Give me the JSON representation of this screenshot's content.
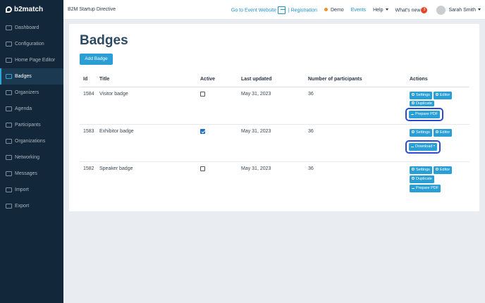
{
  "app": {
    "logo": "b2match",
    "event_title": "B2M Startup Directive"
  },
  "topnav": {
    "event_website": "Go to Event Website",
    "registration": "| Registration",
    "demo": "Demo",
    "events": "Events",
    "help": "Help",
    "whats_new": "What's new",
    "whats_new_count": "3",
    "user": "Sarah Smith"
  },
  "sidebar": {
    "items": [
      {
        "label": "Dashboard",
        "icon": "dashboard-icon"
      },
      {
        "label": "Configuration",
        "icon": "link-icon"
      },
      {
        "label": "Home Page Editor",
        "icon": "page-icon"
      },
      {
        "label": "Badges",
        "icon": "badge-icon"
      },
      {
        "label": "Organizers",
        "icon": "users-icon"
      },
      {
        "label": "Agenda",
        "icon": "calendar-icon"
      },
      {
        "label": "Participants",
        "icon": "person-icon"
      },
      {
        "label": "Organizations",
        "icon": "building-icon"
      },
      {
        "label": "Networking",
        "icon": "handshake-icon"
      },
      {
        "label": "Messages",
        "icon": "envelope-icon"
      },
      {
        "label": "Import",
        "icon": "import-icon"
      },
      {
        "label": "Export",
        "icon": "export-icon"
      }
    ],
    "active_index": 3
  },
  "main": {
    "title": "Badges",
    "add_button": "Add Badge",
    "columns": [
      "Id",
      "Title",
      "Active",
      "Last updated",
      "Number of participants",
      "Actions"
    ],
    "rows": [
      {
        "id": "1584",
        "title": "Visitor badge",
        "active": false,
        "updated": "May 31, 2023",
        "participants": "36"
      },
      {
        "id": "1583",
        "title": "Exhibitor badge",
        "active": true,
        "updated": "May 31, 2023",
        "participants": "36"
      },
      {
        "id": "1582",
        "title": "Speaker badge",
        "active": false,
        "updated": "May 31, 2023",
        "participants": "36"
      }
    ],
    "actions": {
      "settings": "Settings",
      "editor": "Editor",
      "duplicate": "Duplicate",
      "prepare_pdf": "Prepare PDF",
      "download": "Download"
    }
  },
  "colors": {
    "sidebar_bg": "#12283a",
    "accent": "#2a9fd6",
    "highlight": "#2a4bd1",
    "title": "#2d4a63"
  }
}
